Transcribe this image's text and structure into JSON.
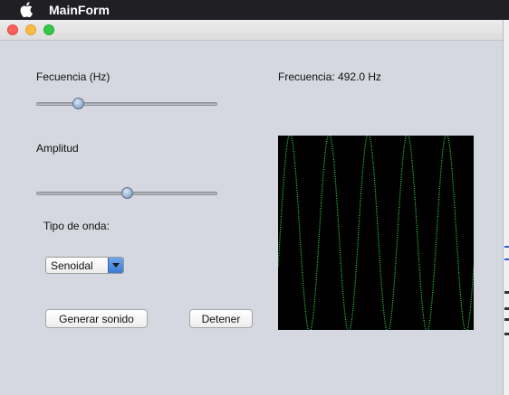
{
  "menubar": {
    "app_name": "MainForm",
    "apple_icon": "apple-logo-icon"
  },
  "window": {
    "title": "",
    "controls": [
      "close",
      "minimize",
      "maximize"
    ]
  },
  "form": {
    "frequency_label": "Fecuencia (Hz)",
    "frequency_slider_value": 0.23,
    "amplitude_label": "Amplitud",
    "amplitude_slider_value": 0.5,
    "wave_type_label": "Tipo de onda:",
    "wave_type_selected": "Senoidal",
    "generate_button": "Generar sonido",
    "stop_button": "Detener",
    "frequency_readout": "Frecuencia: 492.0 Hz"
  },
  "wave_display": {
    "background": "#000000",
    "trace_color": "#2ee04a",
    "cycles_shown": 5,
    "amplitude_fraction": 0.5
  }
}
